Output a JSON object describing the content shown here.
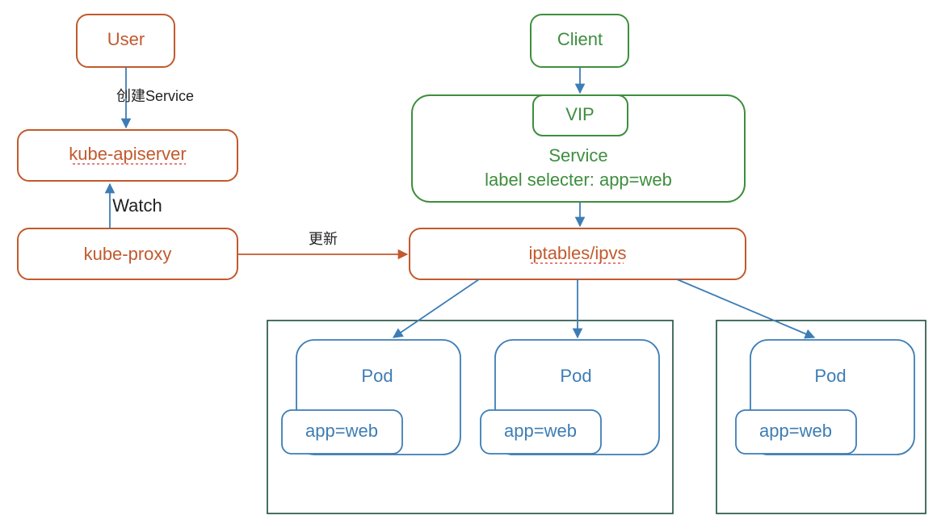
{
  "nodes": {
    "user": "User",
    "apiserver": "kube-apiserver",
    "kubeproxy": "kube-proxy",
    "client": "Client",
    "vip": "VIP",
    "service_title": "Service",
    "service_selector": "label selecter: app=web",
    "iptables": "iptables/ipvs",
    "pod": "Pod",
    "label": "app=web"
  },
  "edges": {
    "create_service": "创建Service",
    "watch": "Watch",
    "update": "更新"
  },
  "colors": {
    "orange": "#c15a2d",
    "green": "#3e8e3e",
    "blue": "#3d7db5",
    "teal": "#1b4d3e",
    "red": "#d93030"
  }
}
